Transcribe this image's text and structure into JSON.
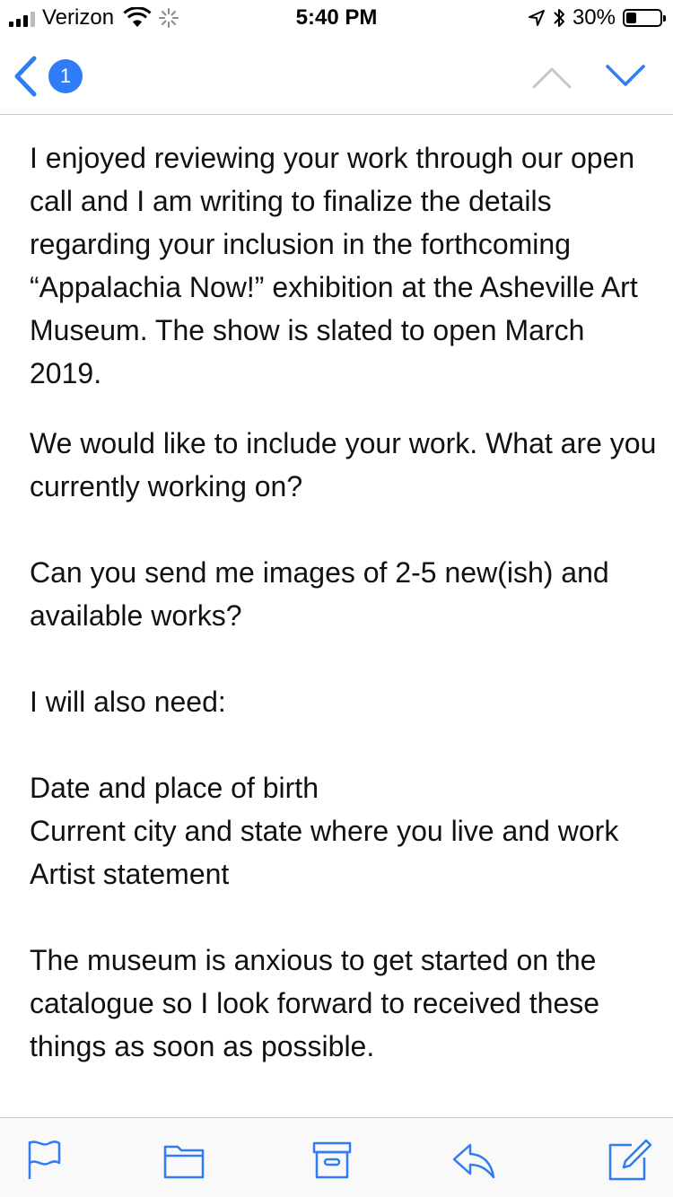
{
  "status_bar": {
    "carrier": "Verizon",
    "time": "5:40 PM",
    "battery_percent": "30%",
    "battery_level": 0.3,
    "icons": [
      "signal-icon",
      "wifi-icon",
      "activity-spinner-icon",
      "location-arrow-icon",
      "bluetooth-icon",
      "battery-icon"
    ]
  },
  "nav": {
    "back_icon": "chevron-left-icon",
    "unread_count": "1",
    "prev_icon": "chevron-up-icon",
    "next_icon": "chevron-down-icon",
    "accent_color": "#2f7cf6",
    "disabled_color": "#c7c7cc"
  },
  "message": {
    "paragraphs": [
      "I enjoyed reviewing your work through our open call and I am writing to finalize the details regarding your inclusion in the forthcoming “Appalachia Now!” exhibition at the Asheville Art Museum. The show is slated to open March 2019.",
      "We would like to include your work. What are you currently working on?",
      "Can you send me images of 2-5 new(ish) and available works?",
      "I will also need:"
    ],
    "requirements": [
      "Date and place of birth",
      "Current city and state where you live and work",
      "Artist statement"
    ],
    "closing": "The museum is anxious to get started on the catalogue so I look forward to received these things as soon as possible."
  },
  "toolbar": {
    "icons": [
      "flag-icon",
      "folder-icon",
      "archive-icon",
      "reply-icon",
      "compose-icon"
    ],
    "icon_color": "#2f7cf6"
  }
}
